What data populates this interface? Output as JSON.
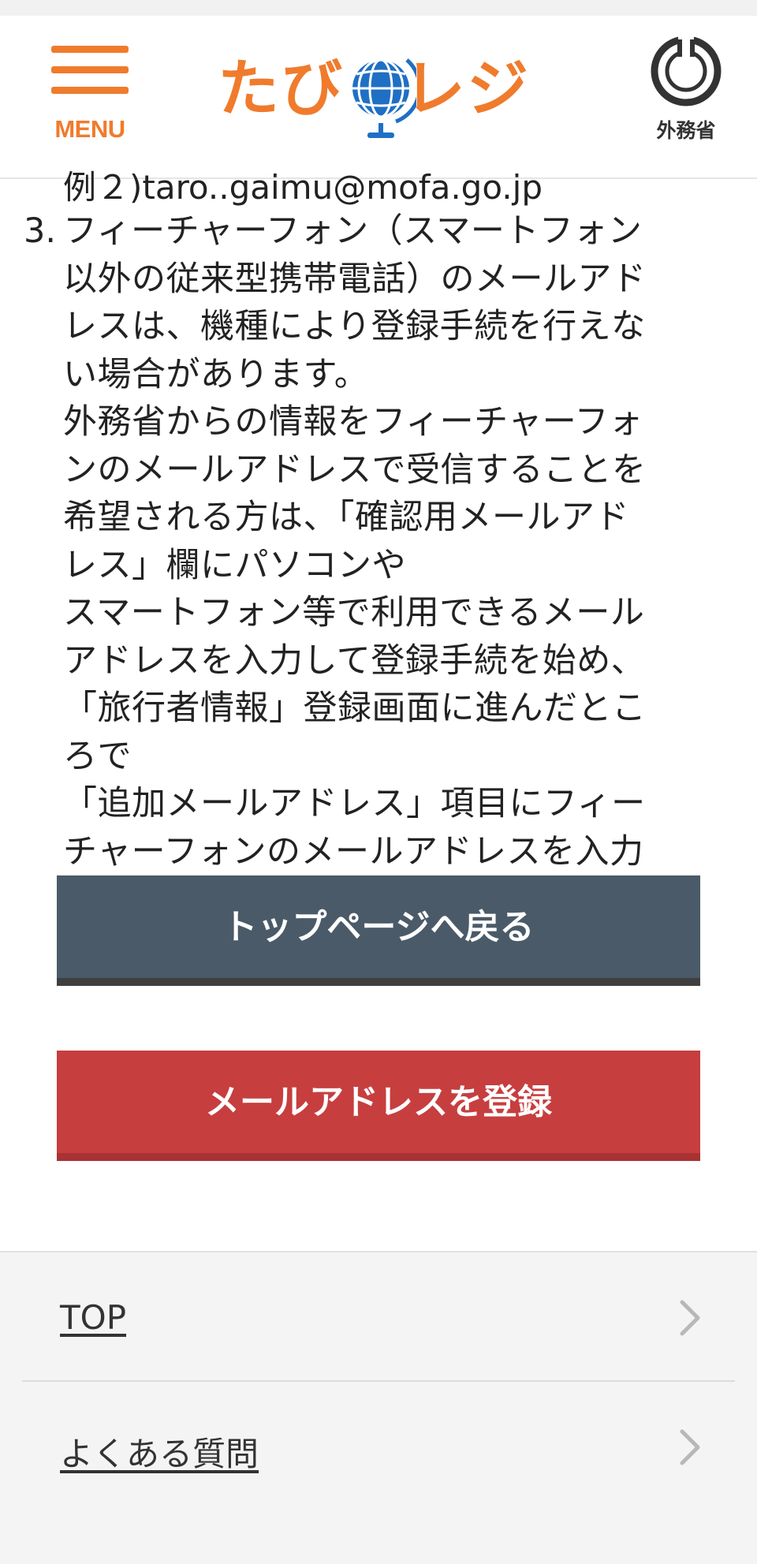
{
  "header": {
    "menu_label": "MENU",
    "logo_left": "たび",
    "logo_right": "レジ",
    "ministry_label": "外務省",
    "brand_color": "#f07b2c"
  },
  "content": {
    "example_text": "例２)taro..gaimu@mofa.go.jp",
    "note_number": "3.",
    "note_text": "フィーチャーフォン（スマートフォン\n以外の従来型携帯電話）のメールアド\nレスは、機種により登録手続を行えな\nい場合があります。\n外務省からの情報をフィーチャーフォ\nンのメールアドレスで受信することを\n希望される方は、「確認用メールアド\nレス」欄にパソコンや\nスマートフォン等で利用できるメール\nアドレスを入力して登録手続を始め、\n「旅行者情報」登録画面に進んだとこ\nろで\n「追加メールアドレス」項目にフィー\nチャーフォンのメールアドレスを入力\nして下さい。"
  },
  "buttons": {
    "top_page": "トップページへ戻る",
    "register_email": "メールアドレスを登録",
    "top_color": "#4a5a68",
    "register_color": "#c73e3f"
  },
  "footer": {
    "items": [
      {
        "label": "TOP",
        "icon": "chevron-right-icon"
      },
      {
        "label": "よくある質問",
        "icon": "chevron-right-icon"
      }
    ]
  }
}
